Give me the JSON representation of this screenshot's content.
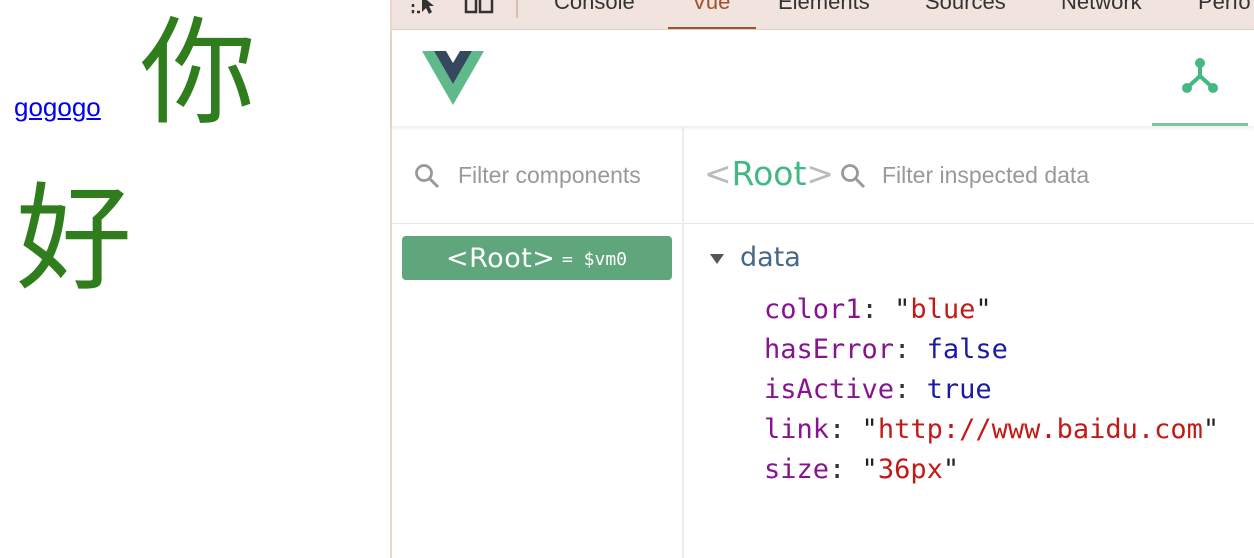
{
  "page": {
    "link_text": "gogogo",
    "text_chars": [
      "你",
      "好"
    ],
    "text_color": "#2f7d1d",
    "link_color": "#0000ee"
  },
  "devtools": {
    "tabs": [
      "Console",
      "Vue",
      "Elements",
      "Sources",
      "Network",
      "Perfo"
    ],
    "active_tab": "Vue",
    "active_tab_color": "#a0522d",
    "tab_bar_color": "#f1e3de"
  },
  "vue": {
    "accent_color": "#42b983",
    "component_filter": {
      "placeholder": "Filter components"
    },
    "inspector": {
      "title_open": "<",
      "title_name": "Root",
      "title_close": ">",
      "filter_placeholder": "Filter inspected data",
      "section": "data",
      "fields": [
        {
          "key": "color1",
          "value": "blue",
          "type": "string"
        },
        {
          "key": "hasError",
          "value": "false",
          "type": "literal"
        },
        {
          "key": "isActive",
          "value": "true",
          "type": "literal"
        },
        {
          "key": "link",
          "value": "http://www.baidu.com",
          "type": "string"
        },
        {
          "key": "size",
          "value": "36px",
          "type": "string"
        }
      ]
    },
    "component_tree": {
      "selected": {
        "tag": "<Root>",
        "vm": "= $vm0",
        "bg_color": "#5fa67c"
      }
    }
  }
}
